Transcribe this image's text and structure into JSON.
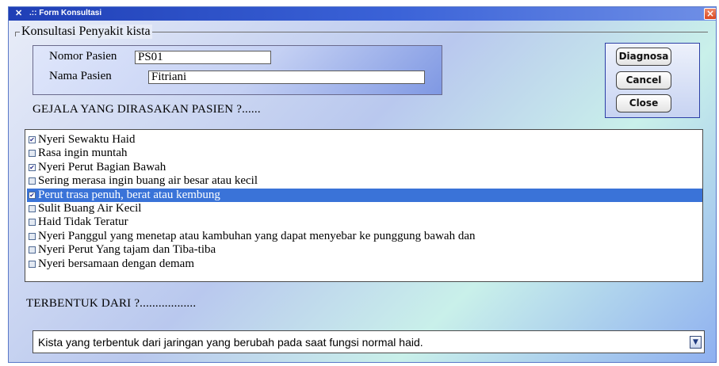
{
  "window": {
    "title": ".:: Form Konsultasi",
    "icon": "app-icon",
    "close_glyph": "×"
  },
  "group": {
    "legend": "Konsultasi Penyakit kista"
  },
  "patient": {
    "nomor_label": "Nomor Pasien",
    "nomor_value": "PS01",
    "nama_label": "Nama Pasien",
    "nama_value": "Fitriani"
  },
  "buttons": {
    "diagnosa": "Diagnosa",
    "cancel": "Cancel",
    "close": "Close"
  },
  "symptoms": {
    "heading": "GEJALA YANG DIRASAKAN PASIEN ?......",
    "items": [
      {
        "label": "Nyeri Sewaktu Haid",
        "checked": true,
        "selected": false
      },
      {
        "label": "Rasa ingin muntah",
        "checked": false,
        "selected": false
      },
      {
        "label": "Nyeri Perut Bagian Bawah",
        "checked": true,
        "selected": false
      },
      {
        "label": "Sering merasa ingin buang air besar atau kecil",
        "checked": false,
        "selected": false
      },
      {
        "label": "Perut trasa penuh, berat atau kembung",
        "checked": true,
        "selected": true
      },
      {
        "label": "Sulit Buang Air Kecil",
        "checked": false,
        "selected": false
      },
      {
        "label": "Haid Tidak Teratur",
        "checked": false,
        "selected": false
      },
      {
        "label": "Nyeri Panggul yang menetap atau kambuhan yang dapat menyebar ke punggung bawah dan",
        "checked": false,
        "selected": false
      },
      {
        "label": "Nyeri Perut Yang tajam dan Tiba-tiba",
        "checked": false,
        "selected": false
      },
      {
        "label": "Nyeri bersamaan dengan demam",
        "checked": false,
        "selected": false
      }
    ]
  },
  "formation": {
    "heading": "TERBENTUK DARI ?..................",
    "selected_value": "Kista yang terbentuk dari jaringan yang berubah pada saat fungsi normal haid."
  }
}
